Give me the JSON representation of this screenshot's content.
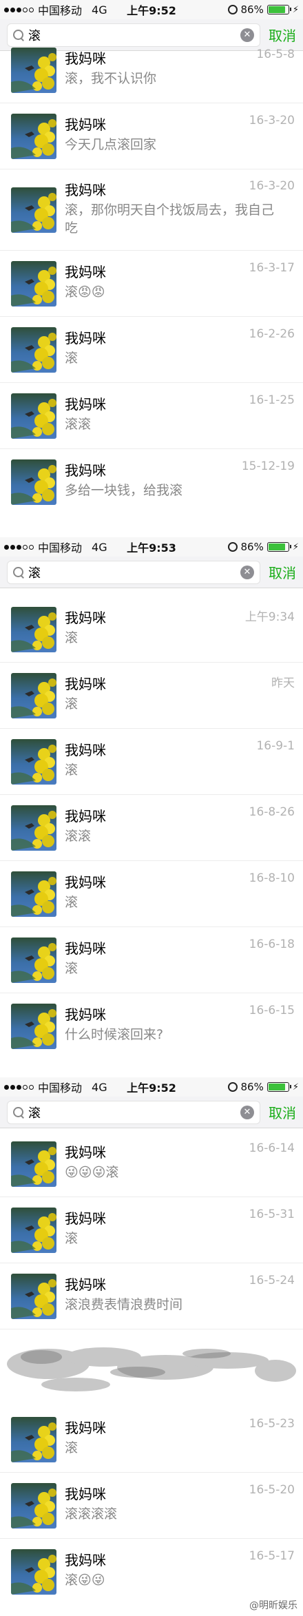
{
  "status_bars": [
    {
      "carrier": "中国移动",
      "network": "4G",
      "time": "上午9:52",
      "battery": "86%"
    },
    {
      "carrier": "中国移动",
      "network": "4G",
      "time": "上午9:53",
      "battery": "86%"
    },
    {
      "carrier": "中国移动",
      "network": "4G",
      "time": "上午9:52",
      "battery": "86%"
    }
  ],
  "search": {
    "query": "滚",
    "cancel_label": "取消"
  },
  "contact_name": "我妈咪",
  "sections": [
    {
      "rows": [
        {
          "name": "我妈咪",
          "date": "16-5-8",
          "message": "滚，我不认识你"
        },
        {
          "name": "我妈咪",
          "date": "16-3-20",
          "message": "今天几点滚回家"
        },
        {
          "name": "我妈咪",
          "date": "16-3-20",
          "message": "滚，那你明天自个找饭局去，我自己吃"
        },
        {
          "name": "我妈咪",
          "date": "16-3-17",
          "message": "滚😡😡"
        },
        {
          "name": "我妈咪",
          "date": "16-2-26",
          "message": "滚"
        },
        {
          "name": "我妈咪",
          "date": "16-1-25",
          "message": "滚滚"
        },
        {
          "name": "我妈咪",
          "date": "15-12-19",
          "message": "多给一块钱，给我滚"
        }
      ]
    },
    {
      "rows": [
        {
          "name": "我妈咪",
          "date": "上午9:34",
          "message": "滚"
        },
        {
          "name": "我妈咪",
          "date": "昨天",
          "message": "滚"
        },
        {
          "name": "我妈咪",
          "date": "16-9-1",
          "message": "滚"
        },
        {
          "name": "我妈咪",
          "date": "16-8-26",
          "message": "滚滚"
        },
        {
          "name": "我妈咪",
          "date": "16-8-10",
          "message": "滚"
        },
        {
          "name": "我妈咪",
          "date": "16-6-18",
          "message": "滚"
        },
        {
          "name": "我妈咪",
          "date": "16-6-15",
          "message": "什么时候滚回来?"
        }
      ]
    },
    {
      "rows": [
        {
          "name": "我妈咪",
          "date": "16-6-14",
          "message": "😜😜😜滚"
        },
        {
          "name": "我妈咪",
          "date": "16-5-31",
          "message": "滚"
        },
        {
          "name": "我妈咪",
          "date": "16-5-24",
          "message": "滚浪费表情浪费时间"
        },
        {
          "name": "我妈咪",
          "date": "16-5-23",
          "message": "滚"
        },
        {
          "name": "我妈咪",
          "date": "16-5-20",
          "message": "滚滚滚滚"
        },
        {
          "name": "我妈咪",
          "date": "16-5-17",
          "message": "滚😜😜"
        }
      ]
    }
  ],
  "watermark": "@明昕娱乐",
  "icons": {
    "search": "search-icon",
    "clear": "clear-icon",
    "alarm": "alarm-icon",
    "battery": "battery-icon",
    "charging": "charging-icon"
  },
  "colors": {
    "accent": "#1aad19",
    "battery": "#3cc13b",
    "date": "#b2b2b2",
    "message": "#888888"
  }
}
